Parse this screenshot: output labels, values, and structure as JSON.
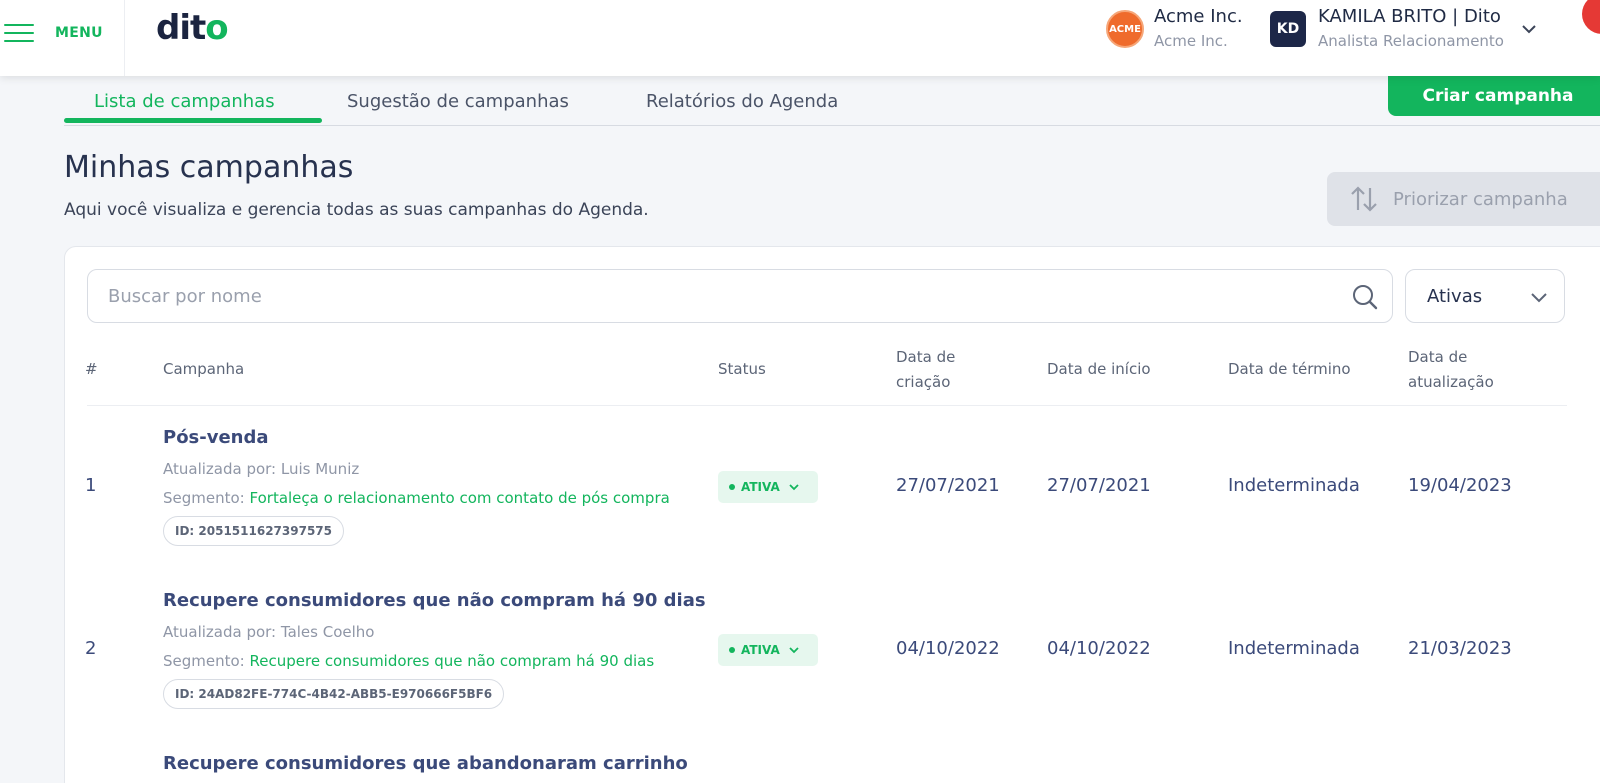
{
  "header": {
    "menu_label": "MENU",
    "logo_text_a": "dit",
    "logo_text_b": "o",
    "account": {
      "logo_text": "ACME",
      "name": "Acme Inc.",
      "sub": "Acme Inc."
    },
    "user": {
      "initials": "KD",
      "name": "KAMILA BRITO | Dito",
      "role": "Analista Relacionamento"
    }
  },
  "tabs": [
    {
      "label": "Lista de campanhas",
      "active": true
    },
    {
      "label": "Sugestão de campanhas",
      "active": false
    },
    {
      "label": "Relatórios do Agenda",
      "active": false
    }
  ],
  "create_button": "Criar campanha",
  "page": {
    "title": "Minhas campanhas",
    "subtitle": "Aqui você visualiza e gerencia todas as suas campanhas do Agenda.",
    "prioritize_button": "Priorizar campanha"
  },
  "search": {
    "placeholder": "Buscar por nome"
  },
  "filter": {
    "selected": "Ativas"
  },
  "table": {
    "headers": {
      "num": "#",
      "campaign": "Campanha",
      "status": "Status",
      "created_1": "Data de",
      "created_2": "criação",
      "start": "Data de início",
      "end": "Data de término",
      "updated_1": "Data de",
      "updated_2": "atualização"
    },
    "rows": [
      {
        "num": "1",
        "title": "Pós-venda",
        "updated_by": "Atualizada por: Luis Muniz",
        "segment_label": "Segmento: ",
        "segment": "Fortaleça o relacionamento com contato de pós compra",
        "id": "ID: 2051511627397575",
        "status": "ATIVA",
        "created": "27/07/2021",
        "start": "27/07/2021",
        "end": "Indeterminada",
        "updated": "19/04/2023"
      },
      {
        "num": "2",
        "title": "Recupere consumidores que não compram há 90 dias",
        "updated_by": "Atualizada por: Tales Coelho",
        "segment_label": "Segmento: ",
        "segment": "Recupere consumidores que não compram há 90 dias",
        "id": "ID: 24AD82FE-774C-4B42-ABB5-E970666F5BF6",
        "status": "ATIVA",
        "created": "04/10/2022",
        "start": "04/10/2022",
        "end": "Indeterminada",
        "updated": "21/03/2023"
      },
      {
        "num": "",
        "title": "Recupere consumidores que abandonaram carrinho"
      }
    ]
  },
  "colors": {
    "brand": "#13b55d",
    "navy": "#1d2748",
    "text": "#3b4a7a"
  }
}
